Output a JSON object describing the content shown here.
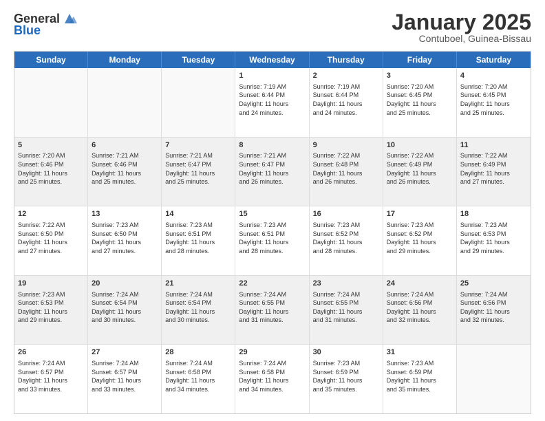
{
  "header": {
    "logo_general": "General",
    "logo_blue": "Blue",
    "title": "January 2025",
    "location": "Contuboel, Guinea-Bissau"
  },
  "days_of_week": [
    "Sunday",
    "Monday",
    "Tuesday",
    "Wednesday",
    "Thursday",
    "Friday",
    "Saturday"
  ],
  "rows": [
    [
      {
        "day": "",
        "text": "",
        "empty": true
      },
      {
        "day": "",
        "text": "",
        "empty": true
      },
      {
        "day": "",
        "text": "",
        "empty": true
      },
      {
        "day": "1",
        "text": "Sunrise: 7:19 AM\nSunset: 6:44 PM\nDaylight: 11 hours\nand 24 minutes.",
        "empty": false
      },
      {
        "day": "2",
        "text": "Sunrise: 7:19 AM\nSunset: 6:44 PM\nDaylight: 11 hours\nand 24 minutes.",
        "empty": false
      },
      {
        "day": "3",
        "text": "Sunrise: 7:20 AM\nSunset: 6:45 PM\nDaylight: 11 hours\nand 25 minutes.",
        "empty": false
      },
      {
        "day": "4",
        "text": "Sunrise: 7:20 AM\nSunset: 6:45 PM\nDaylight: 11 hours\nand 25 minutes.",
        "empty": false
      }
    ],
    [
      {
        "day": "5",
        "text": "Sunrise: 7:20 AM\nSunset: 6:46 PM\nDaylight: 11 hours\nand 25 minutes.",
        "empty": false
      },
      {
        "day": "6",
        "text": "Sunrise: 7:21 AM\nSunset: 6:46 PM\nDaylight: 11 hours\nand 25 minutes.",
        "empty": false
      },
      {
        "day": "7",
        "text": "Sunrise: 7:21 AM\nSunset: 6:47 PM\nDaylight: 11 hours\nand 25 minutes.",
        "empty": false
      },
      {
        "day": "8",
        "text": "Sunrise: 7:21 AM\nSunset: 6:47 PM\nDaylight: 11 hours\nand 26 minutes.",
        "empty": false
      },
      {
        "day": "9",
        "text": "Sunrise: 7:22 AM\nSunset: 6:48 PM\nDaylight: 11 hours\nand 26 minutes.",
        "empty": false
      },
      {
        "day": "10",
        "text": "Sunrise: 7:22 AM\nSunset: 6:49 PM\nDaylight: 11 hours\nand 26 minutes.",
        "empty": false
      },
      {
        "day": "11",
        "text": "Sunrise: 7:22 AM\nSunset: 6:49 PM\nDaylight: 11 hours\nand 27 minutes.",
        "empty": false
      }
    ],
    [
      {
        "day": "12",
        "text": "Sunrise: 7:22 AM\nSunset: 6:50 PM\nDaylight: 11 hours\nand 27 minutes.",
        "empty": false
      },
      {
        "day": "13",
        "text": "Sunrise: 7:23 AM\nSunset: 6:50 PM\nDaylight: 11 hours\nand 27 minutes.",
        "empty": false
      },
      {
        "day": "14",
        "text": "Sunrise: 7:23 AM\nSunset: 6:51 PM\nDaylight: 11 hours\nand 28 minutes.",
        "empty": false
      },
      {
        "day": "15",
        "text": "Sunrise: 7:23 AM\nSunset: 6:51 PM\nDaylight: 11 hours\nand 28 minutes.",
        "empty": false
      },
      {
        "day": "16",
        "text": "Sunrise: 7:23 AM\nSunset: 6:52 PM\nDaylight: 11 hours\nand 28 minutes.",
        "empty": false
      },
      {
        "day": "17",
        "text": "Sunrise: 7:23 AM\nSunset: 6:52 PM\nDaylight: 11 hours\nand 29 minutes.",
        "empty": false
      },
      {
        "day": "18",
        "text": "Sunrise: 7:23 AM\nSunset: 6:53 PM\nDaylight: 11 hours\nand 29 minutes.",
        "empty": false
      }
    ],
    [
      {
        "day": "19",
        "text": "Sunrise: 7:23 AM\nSunset: 6:53 PM\nDaylight: 11 hours\nand 29 minutes.",
        "empty": false
      },
      {
        "day": "20",
        "text": "Sunrise: 7:24 AM\nSunset: 6:54 PM\nDaylight: 11 hours\nand 30 minutes.",
        "empty": false
      },
      {
        "day": "21",
        "text": "Sunrise: 7:24 AM\nSunset: 6:54 PM\nDaylight: 11 hours\nand 30 minutes.",
        "empty": false
      },
      {
        "day": "22",
        "text": "Sunrise: 7:24 AM\nSunset: 6:55 PM\nDaylight: 11 hours\nand 31 minutes.",
        "empty": false
      },
      {
        "day": "23",
        "text": "Sunrise: 7:24 AM\nSunset: 6:55 PM\nDaylight: 11 hours\nand 31 minutes.",
        "empty": false
      },
      {
        "day": "24",
        "text": "Sunrise: 7:24 AM\nSunset: 6:56 PM\nDaylight: 11 hours\nand 32 minutes.",
        "empty": false
      },
      {
        "day": "25",
        "text": "Sunrise: 7:24 AM\nSunset: 6:56 PM\nDaylight: 11 hours\nand 32 minutes.",
        "empty": false
      }
    ],
    [
      {
        "day": "26",
        "text": "Sunrise: 7:24 AM\nSunset: 6:57 PM\nDaylight: 11 hours\nand 33 minutes.",
        "empty": false
      },
      {
        "day": "27",
        "text": "Sunrise: 7:24 AM\nSunset: 6:57 PM\nDaylight: 11 hours\nand 33 minutes.",
        "empty": false
      },
      {
        "day": "28",
        "text": "Sunrise: 7:24 AM\nSunset: 6:58 PM\nDaylight: 11 hours\nand 34 minutes.",
        "empty": false
      },
      {
        "day": "29",
        "text": "Sunrise: 7:24 AM\nSunset: 6:58 PM\nDaylight: 11 hours\nand 34 minutes.",
        "empty": false
      },
      {
        "day": "30",
        "text": "Sunrise: 7:23 AM\nSunset: 6:59 PM\nDaylight: 11 hours\nand 35 minutes.",
        "empty": false
      },
      {
        "day": "31",
        "text": "Sunrise: 7:23 AM\nSunset: 6:59 PM\nDaylight: 11 hours\nand 35 minutes.",
        "empty": false
      },
      {
        "day": "",
        "text": "",
        "empty": true
      }
    ]
  ]
}
